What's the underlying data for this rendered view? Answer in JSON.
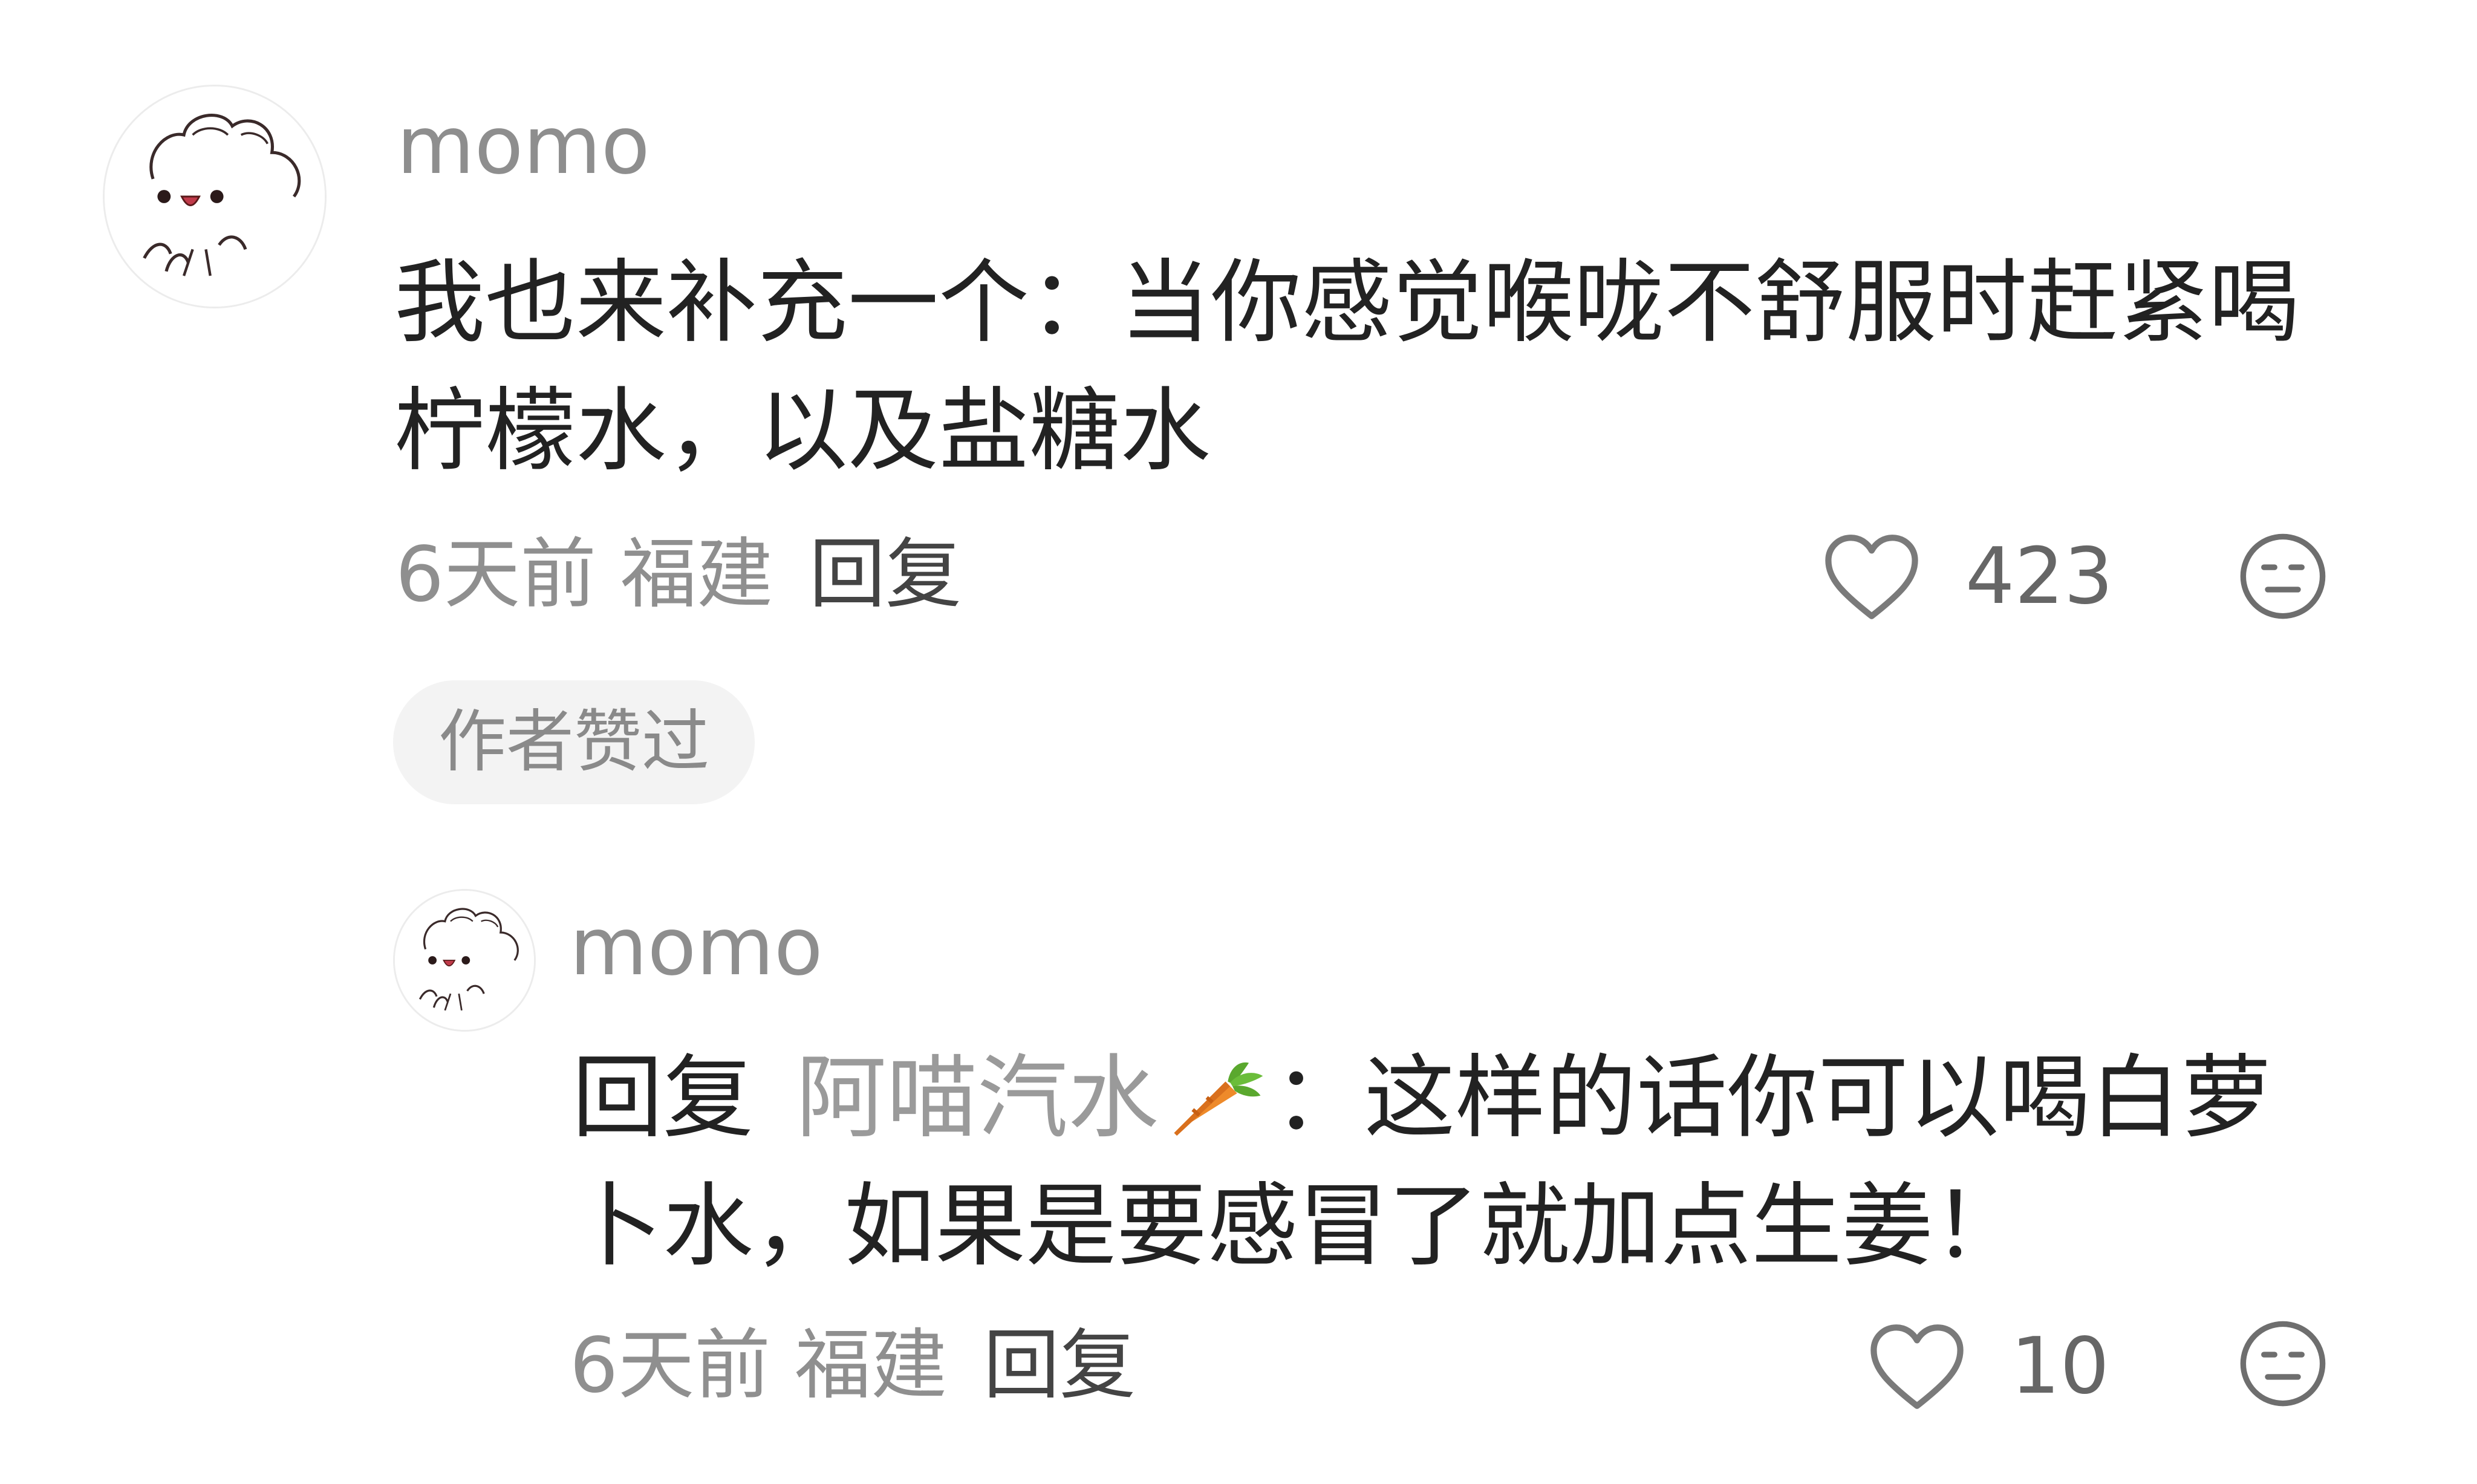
{
  "comments": [
    {
      "username": "momo",
      "text": "我也来补充一个：当你感觉喉咙不舒服时赶紧喝柠檬水，以及盐糖水",
      "time": "6天前",
      "location": "福建",
      "reply_label": "回复",
      "likes": "423",
      "badge": "作者赞过",
      "like_icon": "heart-outline-icon",
      "dislike_icon": "meh-face-icon"
    }
  ],
  "reply": {
    "username": "momo",
    "reply_prefix": "回复",
    "mention": "阿喵汽水",
    "mention_emoji": "carrot-emoji",
    "text": "：这样的话你可以喝白萝卜水，如果是要感冒了就加点生姜！",
    "time": "6天前",
    "location": "福建",
    "reply_label": "回复",
    "likes": "10",
    "like_icon": "heart-outline-icon",
    "dislike_icon": "meh-face-icon"
  },
  "colors": {
    "username": "#8e8e8e",
    "text": "#222222",
    "meta": "#8f8f8f",
    "badge_bg": "#f3f3f3",
    "mention": "#9a9a9a"
  }
}
